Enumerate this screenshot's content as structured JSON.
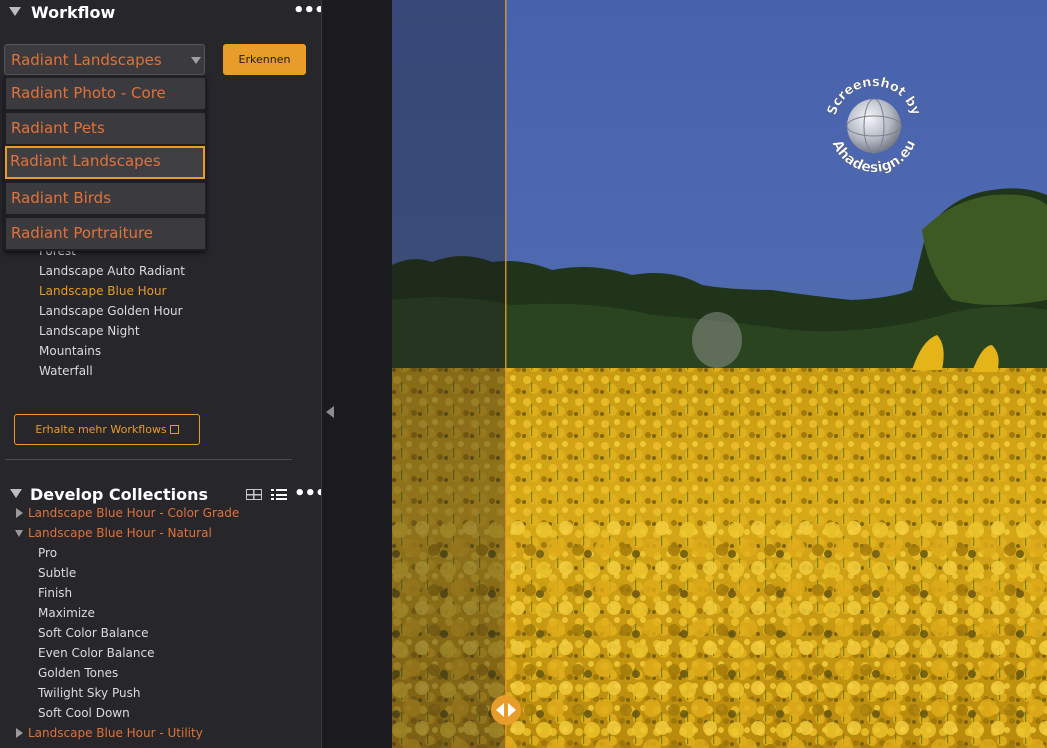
{
  "workflow": {
    "title": "Workflow",
    "selected_workflow": "Radiant Landscapes",
    "detect_button": "Erkennen",
    "dropdown_options": [
      "Radiant Photo - Core",
      "Radiant Pets",
      "Radiant Landscapes",
      "Radiant Birds",
      "Radiant Portraiture"
    ],
    "items": [
      "Forest",
      "Landscape Auto Radiant",
      "Landscape Blue Hour",
      "Landscape Golden Hour",
      "Landscape Night",
      "Mountains",
      "Waterfall"
    ],
    "selected_item": "Landscape Blue Hour",
    "more_button": "Erhalte mehr Workflows"
  },
  "collections": {
    "title": "Develop Collections",
    "groups": [
      {
        "label": "Landscape Blue Hour - Color Grade",
        "expanded": false
      },
      {
        "label": "Landscape Blue Hour - Natural",
        "expanded": true
      },
      {
        "label": "Landscape Blue Hour - Utility",
        "expanded": false
      }
    ],
    "natural_presets": [
      "Pro",
      "Subtle",
      "Finish",
      "Maximize",
      "Soft Color Balance",
      "Even Color Balance",
      "Golden Tones",
      "Twilight Sky Push",
      "Soft Cool Down"
    ]
  },
  "watermark": {
    "top_text": "Screenshot by",
    "bottom_text": "Ahadesign.eu"
  },
  "colors": {
    "accent_orange": "#e89c2a",
    "label_orange": "#e0723a",
    "panel_bg": "#26262b",
    "sky_blue": "#4f69b0",
    "flower_yellow": "#d8a814"
  },
  "icons": {
    "menu": "more-dots-icon",
    "collapse": "collapse-left-icon",
    "compare": "compare-slider-icon",
    "grid": "grid-view-icon",
    "list": "list-view-icon",
    "external": "external-link-icon"
  }
}
